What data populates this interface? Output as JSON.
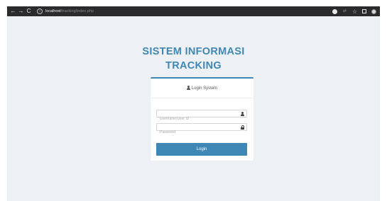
{
  "browser": {
    "back_icon": "←",
    "forward_icon": "→",
    "reload_icon": "C",
    "info_icon": "i",
    "url_host": "localhost",
    "url_path": "/tracking/index.php"
  },
  "page": {
    "title_line1": "SISTEM INFORMASI",
    "title_line2": "TRACKING",
    "accent_color": "#3f87b4",
    "background_color": "#edf0f5"
  },
  "login": {
    "header_label": "Login System",
    "username_placeholder": "Username/User ID",
    "password_placeholder": "Password",
    "submit_label": "Login"
  }
}
